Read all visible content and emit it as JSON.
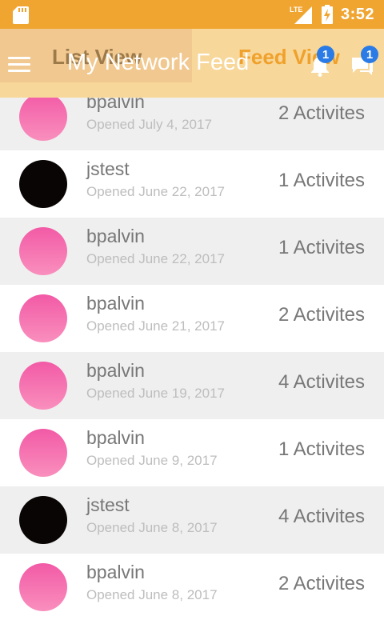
{
  "status_bar": {
    "time": "3:52",
    "network": "LTE",
    "icons": [
      "sd-card-icon",
      "signal-icon",
      "battery-charging-icon"
    ]
  },
  "app_bar": {
    "title": "My Network Feed",
    "tabs": [
      {
        "label": "List View",
        "selected": false
      },
      {
        "label": "Feed View",
        "selected": true
      }
    ],
    "notifications_badge": "1",
    "messages_badge": "1",
    "colors": {
      "status_bar": "#f0a531",
      "app_bar": "#f7d79a",
      "active_tab": "#f0a12b",
      "badge": "#2a7be6"
    }
  },
  "feed": [
    {
      "user": "bpalvin",
      "opened": "Opened July 4, 2017",
      "activities": "2 Activites",
      "avatar": "pink"
    },
    {
      "user": "jstest",
      "opened": "Opened June 22, 2017",
      "activities": "1 Activites",
      "avatar": "black"
    },
    {
      "user": "bpalvin",
      "opened": "Opened June 22, 2017",
      "activities": "1 Activites",
      "avatar": "pink"
    },
    {
      "user": "bpalvin",
      "opened": "Opened June 21, 2017",
      "activities": "2 Activites",
      "avatar": "pink"
    },
    {
      "user": "bpalvin",
      "opened": "Opened June 19, 2017",
      "activities": "4 Activites",
      "avatar": "pink"
    },
    {
      "user": "bpalvin",
      "opened": "Opened June 9, 2017",
      "activities": "1 Activites",
      "avatar": "pink"
    },
    {
      "user": "jstest",
      "opened": "Opened June 8, 2017",
      "activities": "4 Activites",
      "avatar": "black"
    },
    {
      "user": "bpalvin",
      "opened": "Opened June 8, 2017",
      "activities": "2 Activites",
      "avatar": "pink"
    }
  ]
}
